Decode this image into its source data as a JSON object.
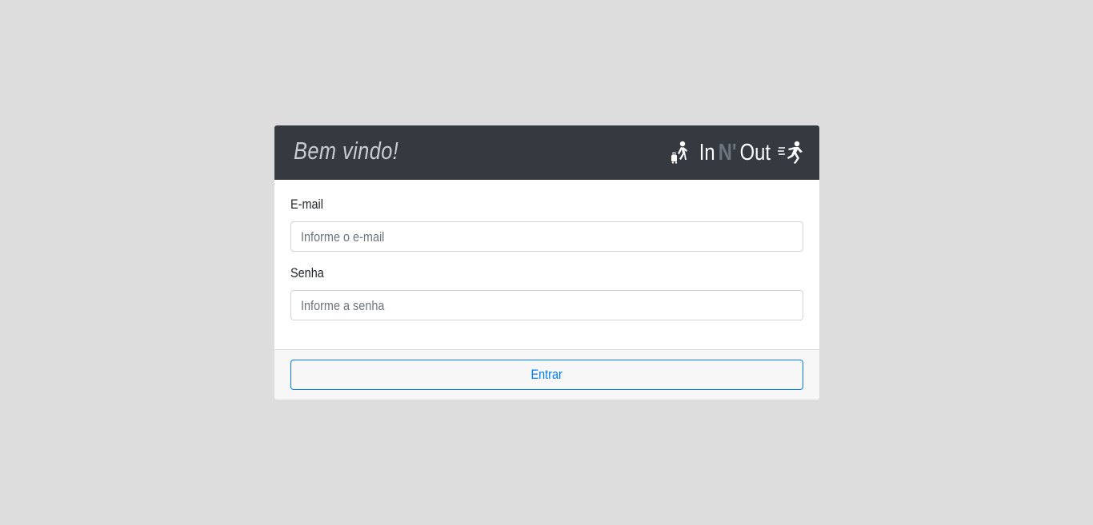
{
  "header": {
    "welcome": "Bem vindo!",
    "logo": {
      "left_icon": "walking-with-luggage-icon",
      "in": "In",
      "n": "N'",
      "out": "Out",
      "right_icon": "running-icon"
    }
  },
  "form": {
    "email": {
      "label": "E-mail",
      "placeholder": "Informe o e-mail"
    },
    "password": {
      "label": "Senha",
      "placeholder": "Informe a senha"
    }
  },
  "footer": {
    "submit_label": "Entrar"
  },
  "colors": {
    "background": "#dddddd",
    "header": "#343a40",
    "primary": "#007bff",
    "muted": "#6c757d"
  }
}
